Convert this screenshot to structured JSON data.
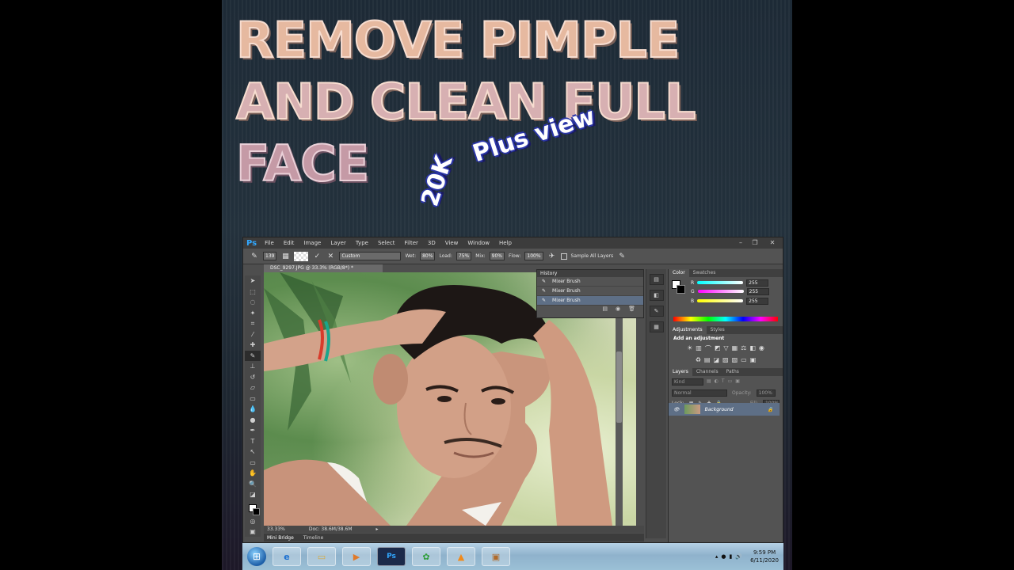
{
  "title": {
    "line1": "REMOVE PIMPLE",
    "line2": "AND CLEAN FULL",
    "line3": "FACE"
  },
  "arc_text": {
    "part1": "20K",
    "part2": "Plus view"
  },
  "photoshop": {
    "logo": "Ps",
    "menu": [
      "File",
      "Edit",
      "Image",
      "Layer",
      "Type",
      "Select",
      "Filter",
      "3D",
      "View",
      "Window",
      "Help"
    ],
    "options": {
      "brush_size": "139",
      "preset": "Custom",
      "wet_label": "Wet:",
      "wet": "80%",
      "load_label": "Load:",
      "load": "75%",
      "mix_label": "Mix:",
      "mix": "90%",
      "flow_label": "Flow:",
      "flow": "100%",
      "sample_all": "Sample All Layers"
    },
    "doc_tab": "DSC_9297.JPG @ 33.3% (RGB/8*) *",
    "history": {
      "title": "History",
      "items": [
        "Mixer Brush",
        "Mixer Brush",
        "Mixer Brush"
      ]
    },
    "color": {
      "tab1": "Color",
      "tab2": "Swatches",
      "r_label": "R",
      "g_label": "G",
      "b_label": "B",
      "r": "255",
      "g": "255",
      "b": "255"
    },
    "adjustments": {
      "tab1": "Adjustments",
      "tab2": "Styles",
      "heading": "Add an adjustment"
    },
    "layers": {
      "tab1": "Layers",
      "tab2": "Channels",
      "tab3": "Paths",
      "kind": "Kind",
      "blend": "Normal",
      "opacity_label": "Opacity:",
      "opacity": "100%",
      "lock_label": "Lock:",
      "fill_label": "Fill:",
      "fill": "100%",
      "layer_name": "Background"
    },
    "status": {
      "zoom": "33.33%",
      "doc": "Doc: 38.6M/38.6M"
    },
    "bridge": {
      "tab1": "Mini Bridge",
      "tab2": "Timeline"
    }
  },
  "taskbar": {
    "time": "9:59 PM",
    "date": "6/11/2020"
  }
}
